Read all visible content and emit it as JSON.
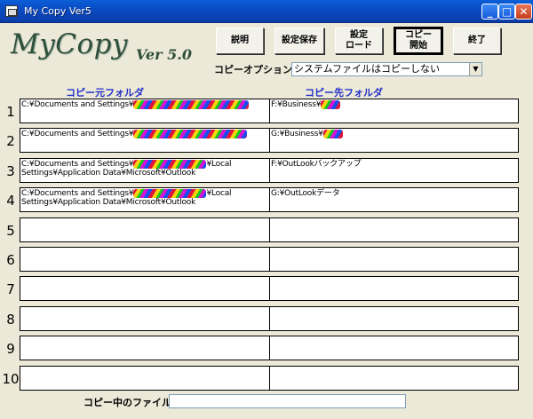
{
  "window": {
    "title": "My Copy Ver5",
    "min_glyph": "_",
    "max_glyph": "□",
    "close_glyph": "✕"
  },
  "logo": {
    "name": "MyCopy",
    "version": "Ver 5.0"
  },
  "buttons": {
    "help": "説明",
    "save": "設定保存",
    "load": "設定\nロード",
    "start": "コピー\n開始",
    "exit": "終了"
  },
  "options": {
    "label": "コピーオプション",
    "value": "システムファイルはコピーしない"
  },
  "columns": {
    "source": "コピー元フォルダ",
    "dest": "コピー先フォルダ"
  },
  "rows": [
    {
      "num": "1",
      "src_a": "C:¥Documents and Settings¥",
      "src_b": "",
      "dst_a": "F:¥Business¥"
    },
    {
      "num": "2",
      "src_a": "C:¥Documents and Settings¥",
      "src_b": "",
      "dst_a": "G:¥Business¥"
    },
    {
      "num": "3",
      "src_a": "C:¥Documents and Settings¥",
      "src_b": "¥Local\nSettings¥Application Data¥Microsoft¥Outlook",
      "dst_a": "F:¥OutLookバックアップ"
    },
    {
      "num": "4",
      "src_a": "C:¥Documents and Settings¥",
      "src_b": "¥Local\nSettings¥Application Data¥Microsoft¥Outlook",
      "dst_a": "G:¥OutLookデータ"
    },
    {
      "num": "5",
      "src_a": "",
      "src_b": "",
      "dst_a": ""
    },
    {
      "num": "6",
      "src_a": "",
      "src_b": "",
      "dst_a": ""
    },
    {
      "num": "7",
      "src_a": "",
      "src_b": "",
      "dst_a": ""
    },
    {
      "num": "8",
      "src_a": "",
      "src_b": "",
      "dst_a": ""
    },
    {
      "num": "9",
      "src_a": "",
      "src_b": "",
      "dst_a": ""
    },
    {
      "num": "10",
      "src_a": "",
      "src_b": "",
      "dst_a": ""
    }
  ],
  "status": {
    "label": "コピー中のファイル:",
    "value": ""
  }
}
